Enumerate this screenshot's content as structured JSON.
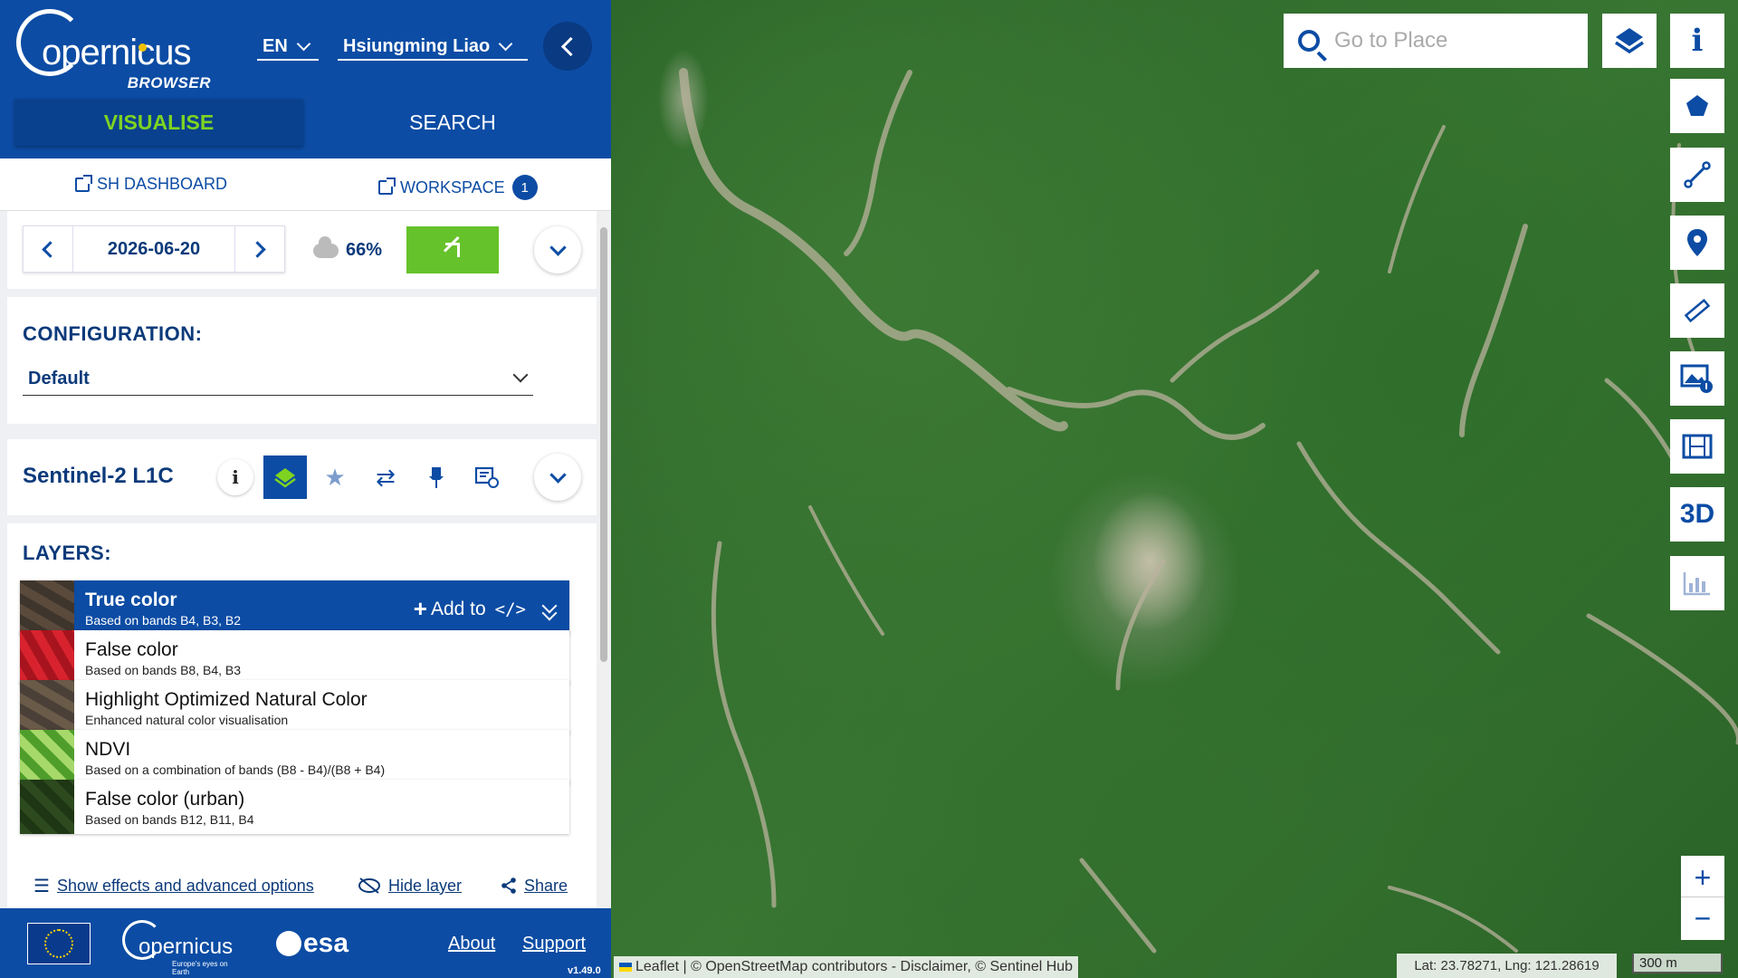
{
  "app": {
    "logo_word": "opernicus",
    "logo_sub": "BROWSER",
    "language": "EN",
    "user": "Hsiungming Liao"
  },
  "tabs": {
    "visualise": "VISUALISE",
    "search": "SEARCH"
  },
  "links": {
    "dashboard": "SH DASHBOARD",
    "workspace": "WORKSPACE",
    "workspace_count": "1"
  },
  "date_panel": {
    "date": "2026-06-20",
    "cloud_cover": "66%"
  },
  "configuration": {
    "title": "CONFIGURATION:",
    "selected": "Default"
  },
  "dataset": {
    "name": "Sentinel-2 L1C"
  },
  "layers": {
    "title": "LAYERS:",
    "add_to": "Add to",
    "items": [
      {
        "title": "True color",
        "subtitle": "Based on bands B4, B3, B2",
        "thumb": "#5a4a3c"
      },
      {
        "title": "False color",
        "subtitle": "Based on bands B8, B4, B3",
        "thumb": "#d8232f"
      },
      {
        "title": "Highlight Optimized Natural Color",
        "subtitle": "Enhanced natural color visualisation",
        "thumb": "#4a4038"
      },
      {
        "title": "NDVI",
        "subtitle": "Based on a combination of bands (B8 - B4)/(B8 + B4)",
        "thumb": "#4f9e2c"
      },
      {
        "title": "False color (urban)",
        "subtitle": "Based on bands B12, B11, B4",
        "thumb": "#2c4a1e"
      }
    ]
  },
  "actions": {
    "effects": "Show effects and advanced options",
    "hide": "Hide layer",
    "share": "Share"
  },
  "footer": {
    "copernicus": "opernicus",
    "copernicus_sub": "Europe's eyes on Earth",
    "esa": "esa",
    "about": "About",
    "support": "Support",
    "version": "v1.49.0"
  },
  "map": {
    "search_placeholder": "Go to Place",
    "tools_3d": "3D",
    "zoom_in": "+",
    "zoom_out": "−",
    "attribution": "Leaflet | © OpenStreetMap contributors - Disclaimer, © Sentinel Hub",
    "coords": "Lat: 23.78271, Lng: 121.28619",
    "scale": "300 m"
  },
  "colors": {
    "brand": "#0c4ca4",
    "accent": "#7ed321",
    "search_green": "#66c22a"
  }
}
